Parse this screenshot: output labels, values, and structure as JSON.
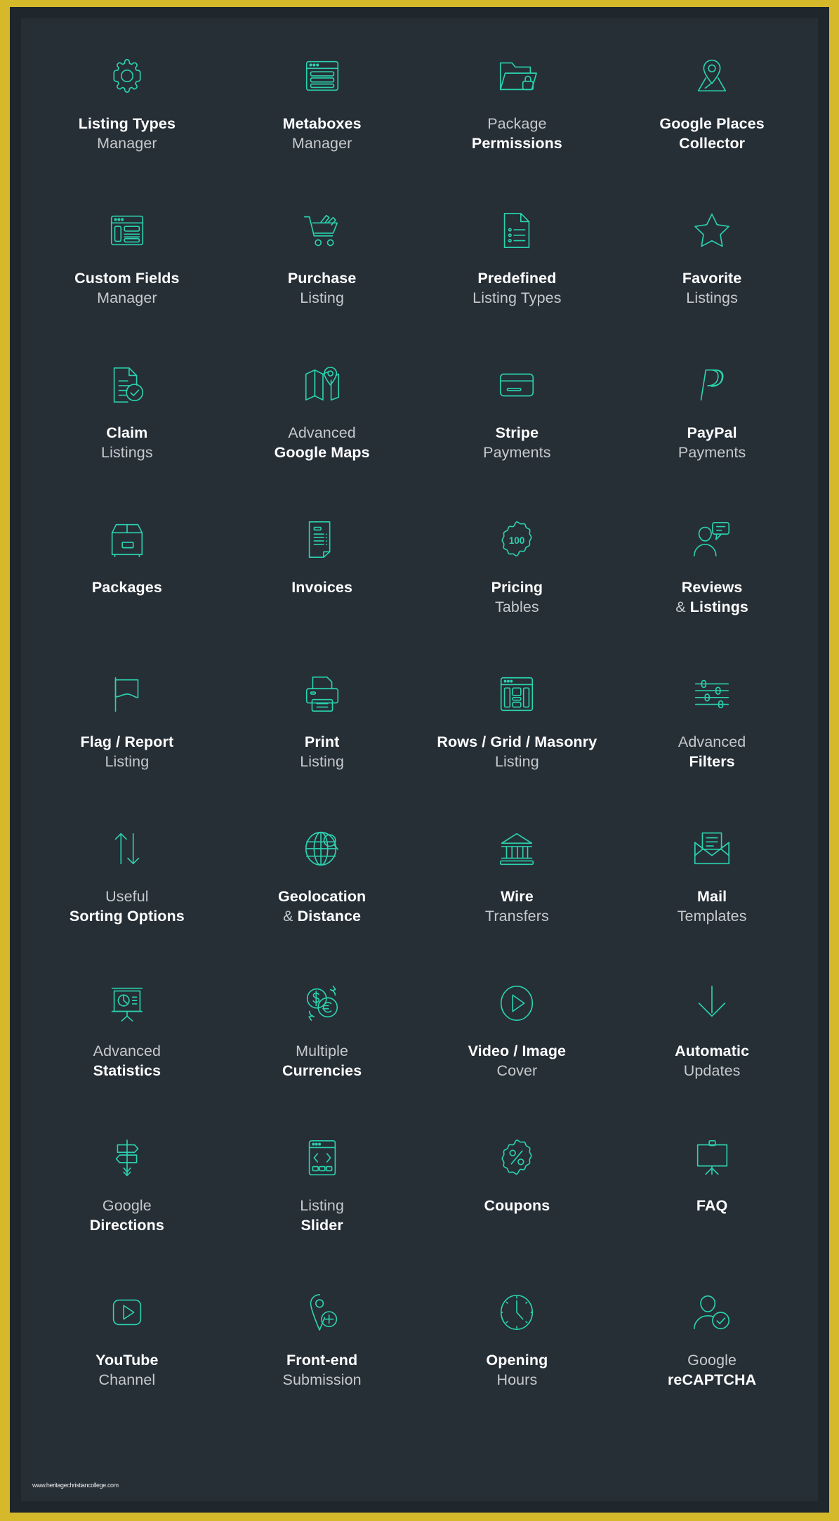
{
  "colors": {
    "frame": "#d6b92a",
    "background": "#262e36",
    "icon_accent": "#2bd1ae",
    "text_bold": "#ffffff",
    "text_light": "#c6cacd"
  },
  "watermark": "www.heritagechristiancollege.com",
  "grid": {
    "columns": 4,
    "rows": 9,
    "items": [
      {
        "icon": "gear-icon",
        "line1": "Listing Types",
        "line2": "Manager",
        "line1_weight": "bold",
        "line2_weight": "light"
      },
      {
        "icon": "metaboxes-window-icon",
        "line1": "Metaboxes",
        "line2": "Manager",
        "line1_weight": "bold",
        "line2_weight": "light"
      },
      {
        "icon": "folder-lock-icon",
        "line1": "Package",
        "line2": "Permissions",
        "line1_weight": "light",
        "line2_weight": "bold"
      },
      {
        "icon": "map-pin-place-icon",
        "line1": "Google Places",
        "line2": "Collector",
        "line1_weight": "bold",
        "line2_weight": "bold"
      },
      {
        "icon": "layout-fields-icon",
        "line1": "Custom Fields",
        "line2": "Manager",
        "line1_weight": "bold",
        "line2_weight": "light"
      },
      {
        "icon": "shopping-cart-icon",
        "line1": "Purchase",
        "line2": "Listing",
        "line1_weight": "bold",
        "line2_weight": "light"
      },
      {
        "icon": "document-list-icon",
        "line1": "Predefined",
        "line2": "Listing Types",
        "line1_weight": "bold",
        "line2_weight": "light"
      },
      {
        "icon": "star-icon",
        "line1": "Favorite",
        "line2": "Listings",
        "line1_weight": "bold",
        "line2_weight": "light"
      },
      {
        "icon": "document-check-icon",
        "line1": "Claim",
        "line2": "Listings",
        "line1_weight": "bold",
        "line2_weight": "light"
      },
      {
        "icon": "folded-map-pin-icon",
        "line1": "Advanced",
        "line2": "Google Maps",
        "line1_weight": "light",
        "line2_weight": "bold"
      },
      {
        "icon": "credit-card-icon",
        "line1": "Stripe",
        "line2": "Payments",
        "line1_weight": "bold",
        "line2_weight": "light"
      },
      {
        "icon": "paypal-icon",
        "line1": "PayPal",
        "line2": "Payments",
        "line1_weight": "bold",
        "line2_weight": "light"
      },
      {
        "icon": "box-package-icon",
        "line1": "Packages",
        "line2": "",
        "line1_weight": "bold",
        "line2_weight": "light"
      },
      {
        "icon": "invoice-icon",
        "line1": "Invoices",
        "line2": "",
        "line1_weight": "bold",
        "line2_weight": "light"
      },
      {
        "icon": "badge-100-icon",
        "line1": "Pricing",
        "line2": "Tables",
        "line1_weight": "bold",
        "line2_weight": "light"
      },
      {
        "icon": "user-comment-icon",
        "line1": "Reviews",
        "line2": "& Listings",
        "line1_weight": "bold",
        "line2_weight": "bold_amp"
      },
      {
        "icon": "flag-icon",
        "line1": "Flag / Report",
        "line2": "Listing",
        "line1_weight": "bold",
        "line2_weight": "light"
      },
      {
        "icon": "printer-icon",
        "line1": "Print",
        "line2": "Listing",
        "line1_weight": "bold",
        "line2_weight": "light"
      },
      {
        "icon": "layout-grid-icon",
        "line1": "Rows / Grid / Masonry",
        "line2": "Listing",
        "line1_weight": "bold",
        "line2_weight": "light"
      },
      {
        "icon": "sliders-icon",
        "line1": "Advanced",
        "line2": "Filters",
        "line1_weight": "light",
        "line2_weight": "bold"
      },
      {
        "icon": "sort-arrows-icon",
        "line1": "Useful",
        "line2": "Sorting Options",
        "line1_weight": "light",
        "line2_weight": "bold"
      },
      {
        "icon": "globe-search-icon",
        "line1": "Geolocation",
        "line2": "& Distance",
        "line1_weight": "bold",
        "line2_weight": "bold_amp"
      },
      {
        "icon": "bank-icon",
        "line1": "Wire",
        "line2": "Transfers",
        "line1_weight": "bold",
        "line2_weight": "light"
      },
      {
        "icon": "mail-envelope-icon",
        "line1": "Mail",
        "line2": "Templates",
        "line1_weight": "bold",
        "line2_weight": "light"
      },
      {
        "icon": "presentation-chart-icon",
        "line1": "Advanced",
        "line2": "Statistics",
        "line1_weight": "light",
        "line2_weight": "bold"
      },
      {
        "icon": "currency-exchange-icon",
        "line1": "Multiple",
        "line2": "Currencies",
        "line1_weight": "light",
        "line2_weight": "bold"
      },
      {
        "icon": "play-circle-icon",
        "line1": "Video / Image",
        "line2": "Cover",
        "line1_weight": "bold",
        "line2_weight": "light"
      },
      {
        "icon": "download-arrow-icon",
        "line1": "Automatic",
        "line2": "Updates",
        "line1_weight": "bold",
        "line2_weight": "light"
      },
      {
        "icon": "signpost-icon",
        "line1": "Google",
        "line2": "Directions",
        "line1_weight": "light",
        "line2_weight": "bold"
      },
      {
        "icon": "slider-window-icon",
        "line1": "Listing",
        "line2": "Slider",
        "line1_weight": "light",
        "line2_weight": "bold"
      },
      {
        "icon": "coupon-percent-icon",
        "line1": "Coupons",
        "line2": "",
        "line1_weight": "bold",
        "line2_weight": "light"
      },
      {
        "icon": "whiteboard-icon",
        "line1": "FAQ",
        "line2": "",
        "line1_weight": "bold",
        "line2_weight": "light"
      },
      {
        "icon": "play-square-icon",
        "line1": "YouTube",
        "line2": "Channel",
        "line1_weight": "bold",
        "line2_weight": "light"
      },
      {
        "icon": "pin-plus-icon",
        "line1": "Front-end",
        "line2": "Submission",
        "line1_weight": "bold",
        "line2_weight": "light"
      },
      {
        "icon": "clock-icon",
        "line1": "Opening",
        "line2": "Hours",
        "line1_weight": "bold",
        "line2_weight": "light"
      },
      {
        "icon": "user-verified-icon",
        "line1": "Google",
        "line2": "reCAPTCHA",
        "line1_weight": "light",
        "line2_weight": "bold"
      }
    ]
  }
}
